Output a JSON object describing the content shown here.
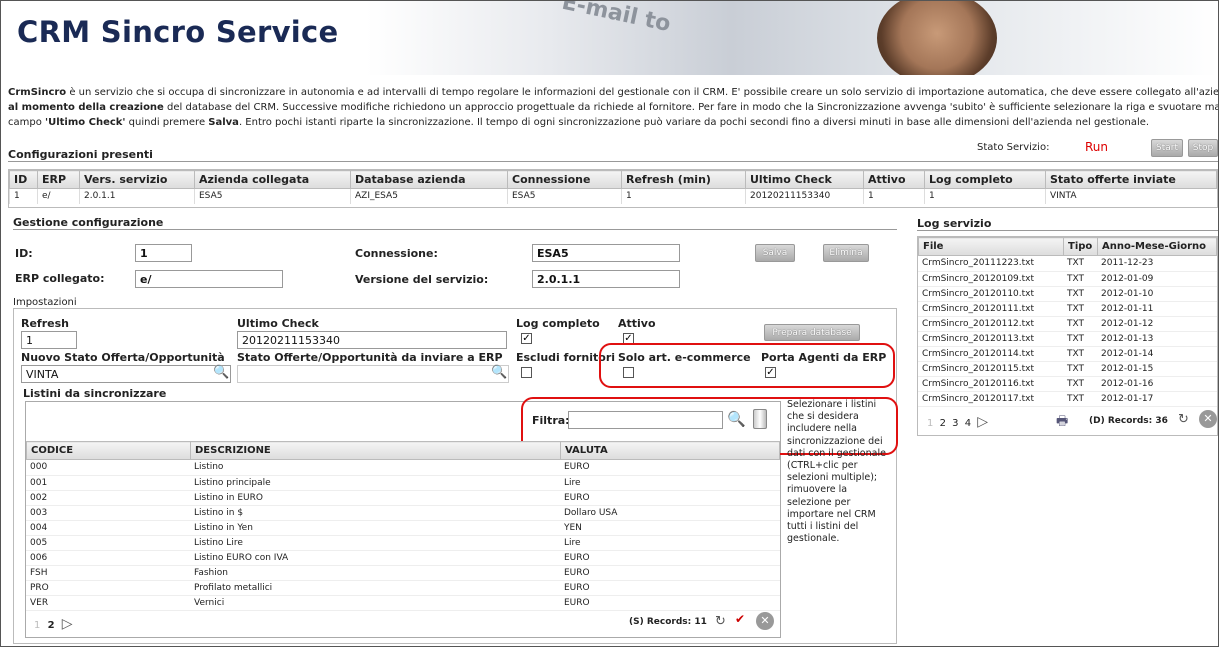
{
  "app": {
    "title": "CRM Sincro Service",
    "banner_deco": "E-mail to"
  },
  "intro": {
    "l1_b": "CrmSincro",
    "l1": " è un servizio che si occupa di sincronizzare in autonomia e ad intervalli di tempo regolare le informazioni del gestionale con il CRM. E' possibile creare un solo servizio di importazione automatica, che deve essere collegato all'azienda gestiona",
    "l2_b": "al momento della creazione",
    "l2": " del database del CRM. Successive modifiche richiedono un approccio progettuale da richiede al fornitore. Per fare in modo che la Sincronizzazione avvenga 'subito' è sufficiente selezionare la riga e svuotare manualmente",
    "l3a": "campo ",
    "l3_b1": "'Ultimo Check'",
    "l3b": " quindi premere ",
    "l3_b2": "Salva",
    "l3c": ". Entro pochi istanti riparte la sincronizzazione. Il tempo di ogni sincronizzazione può variare da pochi secondi fino a diversi minuti in base alle dimensioni dell'azienda nel gestionale."
  },
  "config": {
    "title": "Configurazioni presenti",
    "stato_label": "Stato Servizio:",
    "stato_value": "Run",
    "start": "Start",
    "stop": "Stop",
    "columns": [
      "ID",
      "ERP",
      "Vers. servizio",
      "Azienda collegata",
      "Database azienda",
      "Connessione",
      "Refresh (min)",
      "Ultimo Check",
      "Attivo",
      "Log completo",
      "Stato offerte inviate"
    ],
    "row": [
      "1",
      "e/",
      "2.0.1.1",
      "ESA5",
      "AZI_ESA5",
      "ESA5",
      "1",
      "20120211153340",
      "1",
      "1",
      "VINTA"
    ]
  },
  "gestione": {
    "title": "Gestione configurazione",
    "id_label": "ID:",
    "id_value": "1",
    "erp_label": "ERP collegato:",
    "erp_value": "e/",
    "conn_label": "Connessione:",
    "conn_value": "ESA5",
    "ver_label": "Versione del servizio:",
    "ver_value": "2.0.1.1",
    "salva": "Salva",
    "elimina": "Elimina",
    "impostazioni": "Impostazioni",
    "refresh_label": "Refresh",
    "refresh_value": "1",
    "ultimo_label": "Ultimo Check",
    "ultimo_value": "20120211153340",
    "log_label": "Log completo",
    "attivo_label": "Attivo",
    "prepara": "Prepara database",
    "nuovo_label": "Nuovo Stato Offerta/Opportunità",
    "nuovo_value": "VINTA",
    "stato_inv_label": "Stato Offerte/Opportunità da inviare a ERP",
    "escludi_label": "Escludi fornitori",
    "solo_label": "Solo art. e-commerce",
    "porta_label": "Porta Agenti da ERP",
    "check_mark": "✓"
  },
  "listini": {
    "title": "Listini da sincronizzare",
    "filtra": "Filtra:",
    "columns": [
      "CODICE",
      "DESCRIZIONE",
      "VALUTA"
    ],
    "rows": [
      [
        "000",
        "Listino",
        "EURO"
      ],
      [
        "001",
        "Listino principale",
        "Lire"
      ],
      [
        "002",
        "Listino in EURO",
        "EURO"
      ],
      [
        "003",
        "Listino in $",
        "Dollaro USA"
      ],
      [
        "004",
        "Listino in Yen",
        "YEN"
      ],
      [
        "005",
        "Listino Lire",
        "Lire"
      ],
      [
        "006",
        "Listino EURO con IVA",
        "EURO"
      ],
      [
        "FSH",
        "Fashion",
        "EURO"
      ],
      [
        "PRO",
        "Profilato metallici",
        "EURO"
      ],
      [
        "VER",
        "Vernici",
        "EURO"
      ]
    ],
    "pages": [
      "1",
      "2"
    ],
    "records": "(S) Records: 11",
    "help": [
      "Selezionare i listini",
      "che si desidera",
      "includere nella",
      "sincronizzazione dei",
      "dati con il gestionale",
      "(CTRL+clic per",
      "selezioni multiple);",
      "rimuovere la",
      "selezione per",
      "importare nel CRM",
      "tutti i listini del",
      "gestionale."
    ]
  },
  "log": {
    "title": "Log servizio",
    "columns": [
      "File",
      "Tipo",
      "Anno-Mese-Giorno"
    ],
    "rows": [
      [
        "CrmSincro_20111223.txt",
        "TXT",
        "2011-12-23"
      ],
      [
        "CrmSincro_20120109.txt",
        "TXT",
        "2012-01-09"
      ],
      [
        "CrmSincro_20120110.txt",
        "TXT",
        "2012-01-10"
      ],
      [
        "CrmSincro_20120111.txt",
        "TXT",
        "2012-01-11"
      ],
      [
        "CrmSincro_20120112.txt",
        "TXT",
        "2012-01-12"
      ],
      [
        "CrmSincro_20120113.txt",
        "TXT",
        "2012-01-13"
      ],
      [
        "CrmSincro_20120114.txt",
        "TXT",
        "2012-01-14"
      ],
      [
        "CrmSincro_20120115.txt",
        "TXT",
        "2012-01-15"
      ],
      [
        "CrmSincro_20120116.txt",
        "TXT",
        "2012-01-16"
      ],
      [
        "CrmSincro_20120117.txt",
        "TXT",
        "2012-01-17"
      ]
    ],
    "pages": [
      "1",
      "2",
      "3",
      "4"
    ],
    "records": "(D) Records: 36"
  }
}
